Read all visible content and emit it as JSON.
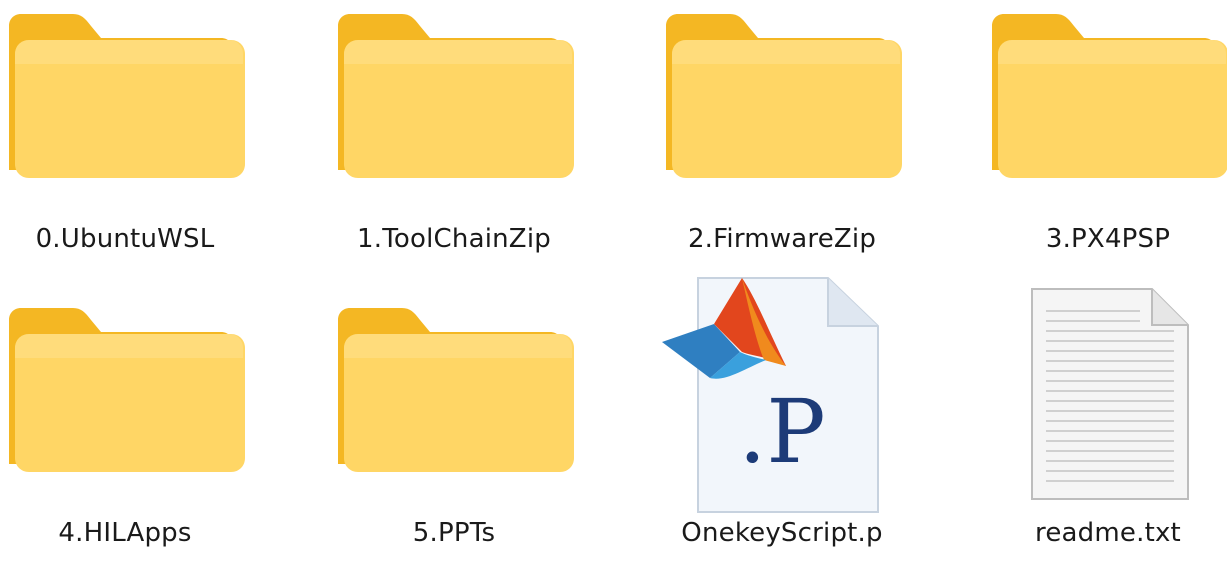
{
  "window": {
    "title": ""
  },
  "items": [
    {
      "name": "0.UbuntuWSL",
      "type": "folder",
      "icon": "folder-icon"
    },
    {
      "name": "1.ToolChainZip",
      "type": "folder",
      "icon": "folder-icon"
    },
    {
      "name": "2.FirmwareZip",
      "type": "folder",
      "icon": "folder-icon"
    },
    {
      "name": "3.PX4PSP",
      "type": "folder",
      "icon": "folder-icon"
    },
    {
      "name": "4.HILApps",
      "type": "folder",
      "icon": "folder-icon"
    },
    {
      "name": "5.PPTs",
      "type": "folder",
      "icon": "folder-icon"
    },
    {
      "name": "OnekeyScript.p",
      "type": "matlab-p-file",
      "icon": "matlab-p-file-icon",
      "icon_text": ".P"
    },
    {
      "name": "readme.txt",
      "type": "text-file",
      "icon": "text-file-icon"
    }
  ],
  "colors": {
    "folder_front": "#ffd665",
    "folder_back": "#f4b723",
    "folder_sheet": "#f3f3f0",
    "p_letter": "#1d3b78",
    "label_text": "#1a1a1a"
  }
}
